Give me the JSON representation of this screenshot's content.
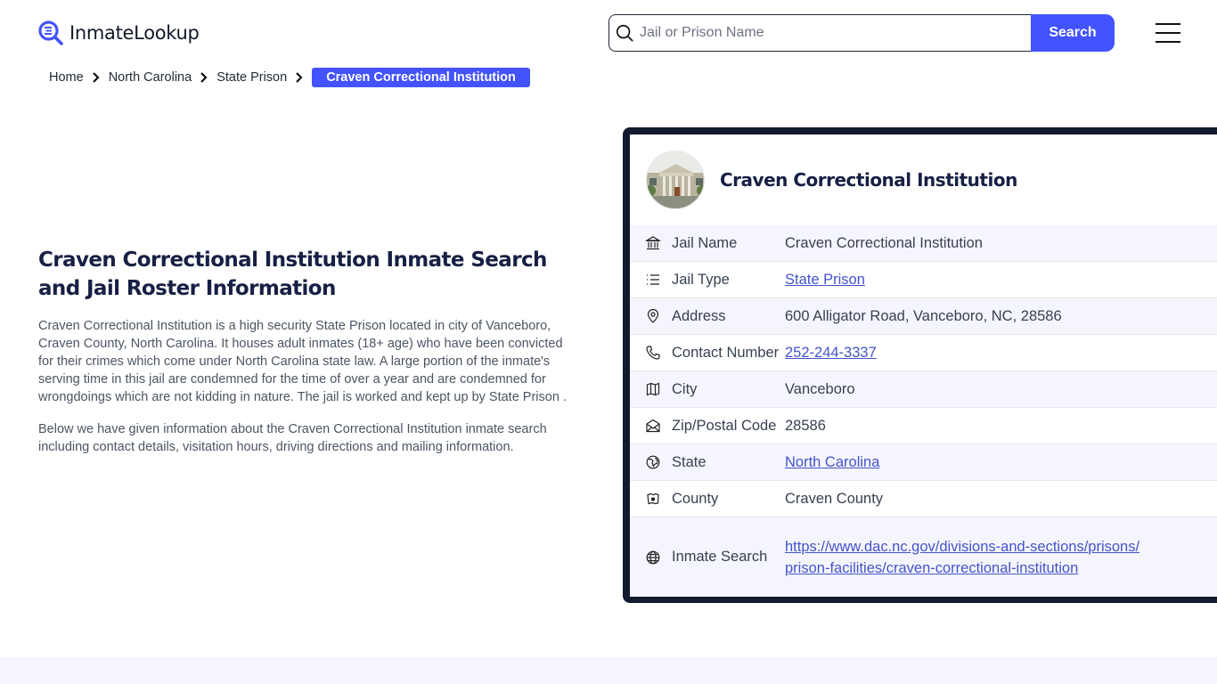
{
  "header": {
    "logo_text": "InmateLookup",
    "search": {
      "placeholder": "Jail or Prison Name",
      "value": "",
      "button_label": "Search"
    },
    "menu_icon": "hamburger-menu-icon"
  },
  "breadcrumb": {
    "items": [
      {
        "label": "Home"
      },
      {
        "label": "North Carolina"
      },
      {
        "label": "State Prison"
      }
    ],
    "current": "Craven Correctional Institution"
  },
  "intro": {
    "title": "Craven Correctional Institution Inmate Search and Jail Roster Information",
    "paragraph_1": "Craven Correctional Institution is a high security State Prison located in city of Vanceboro, Craven County, North Carolina. It houses adult inmates (18+ age) who have been convicted for their crimes which come under North Carolina state law. A large portion of the inmate's serving time in this jail are condemned for the time of over a year and are condemned for wrongdoings which are not kidding in nature. The jail is worked and kept up by State Prison .",
    "paragraph_2": "Below we have given information about the Craven Correctional Institution inmate search including contact details, visitation hours, driving directions and mailing information."
  },
  "card": {
    "title": "Craven Correctional Institution",
    "image_alt": "facility-photo",
    "rows": [
      {
        "icon": "bank-building-icon",
        "label": "Jail Name",
        "value": "Craven Correctional Institution",
        "link": false
      },
      {
        "icon": "list-icon",
        "label": "Jail Type",
        "value": "State Prison",
        "link": true
      },
      {
        "icon": "map-pin-icon",
        "label": "Address",
        "value": "600 Alligator Road, Vanceboro, NC, 28586",
        "link": false
      },
      {
        "icon": "phone-icon",
        "label": "Contact Number",
        "value": "252-244-3337",
        "link": true
      },
      {
        "icon": "map-icon",
        "label": "City",
        "value": "Vanceboro",
        "link": false
      },
      {
        "icon": "mail-open-icon",
        "label": "Zip/Postal Code",
        "value": "28586",
        "link": false
      },
      {
        "icon": "globe-region-icon",
        "label": "State",
        "value": "North Carolina",
        "link": true
      },
      {
        "icon": "county-map-icon",
        "label": "County",
        "value": "Craven County",
        "link": false
      },
      {
        "icon": "globe-icon",
        "label": "Inmate Search",
        "value": "https://www.dac.nc.gov/divisions-and-sections/prisons/prison-facilities/craven-correctional-institution",
        "link": true
      }
    ]
  },
  "colors": {
    "accent": "#4353ff",
    "heading": "#172044",
    "card_border": "#111a2e",
    "row_alt_bg": "#f5f6fd",
    "link": "#4353c9"
  }
}
